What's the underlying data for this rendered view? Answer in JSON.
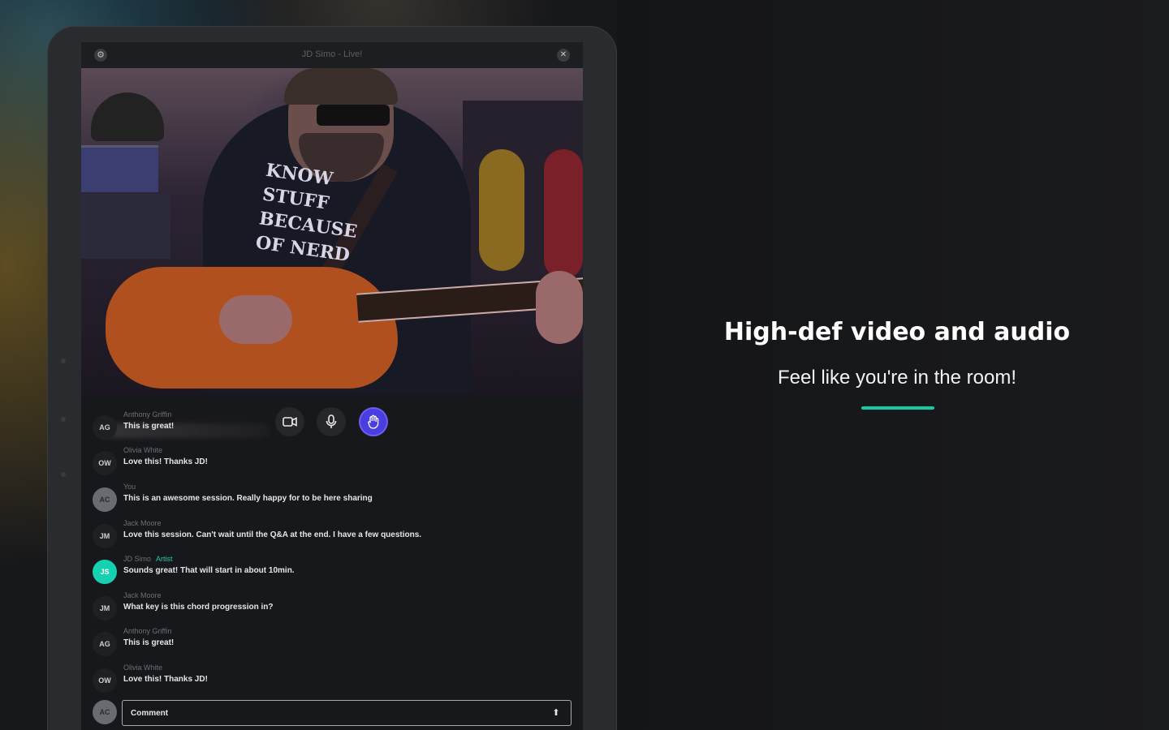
{
  "window": {
    "title": "JD Simo - Live!",
    "settings_icon": "gear-icon",
    "close_icon": "close-icon"
  },
  "video": {
    "shirt_text": "KNOW STUFF BECAUSE OF NERD"
  },
  "controls": {
    "camera_icon": "camera-icon",
    "mic_icon": "microphone-icon",
    "raise_hand_icon": "raise-hand-icon",
    "accent": "#4b3ee0"
  },
  "chat": {
    "messages": [
      {
        "initials": "AG",
        "sender": "Anthony Griffin",
        "badge": "",
        "text": "This is great!"
      },
      {
        "initials": "OW",
        "sender": "Olivia White",
        "badge": "",
        "text": "Love this! Thanks JD!"
      },
      {
        "initials": "AC",
        "sender": "You",
        "badge": "",
        "text": "This is an awesome session. Really happy for to be here sharing"
      },
      {
        "initials": "JM",
        "sender": "Jack Moore",
        "badge": "",
        "text": "Love this session. Can't wait until the Q&A at the end. I have a few questions."
      },
      {
        "initials": "JS",
        "sender": "JD Simo",
        "badge": "Artist",
        "text": "Sounds great! That will start in about 10min."
      },
      {
        "initials": "JM",
        "sender": "Jack Moore",
        "badge": "",
        "text": "What key is this chord progression in?"
      },
      {
        "initials": "AG",
        "sender": "Anthony Griffin",
        "badge": "",
        "text": "This is great!"
      },
      {
        "initials": "OW",
        "sender": "Olivia White",
        "badge": "",
        "text": "Love this! Thanks JD!"
      }
    ],
    "comment_initials": "AC",
    "comment_placeholder": "Comment",
    "send_icon": "send-arrow-icon"
  },
  "promo": {
    "headline": "High-def video and audio",
    "subline": "Feel like you're in the room!",
    "accent": "#16c9a5"
  }
}
